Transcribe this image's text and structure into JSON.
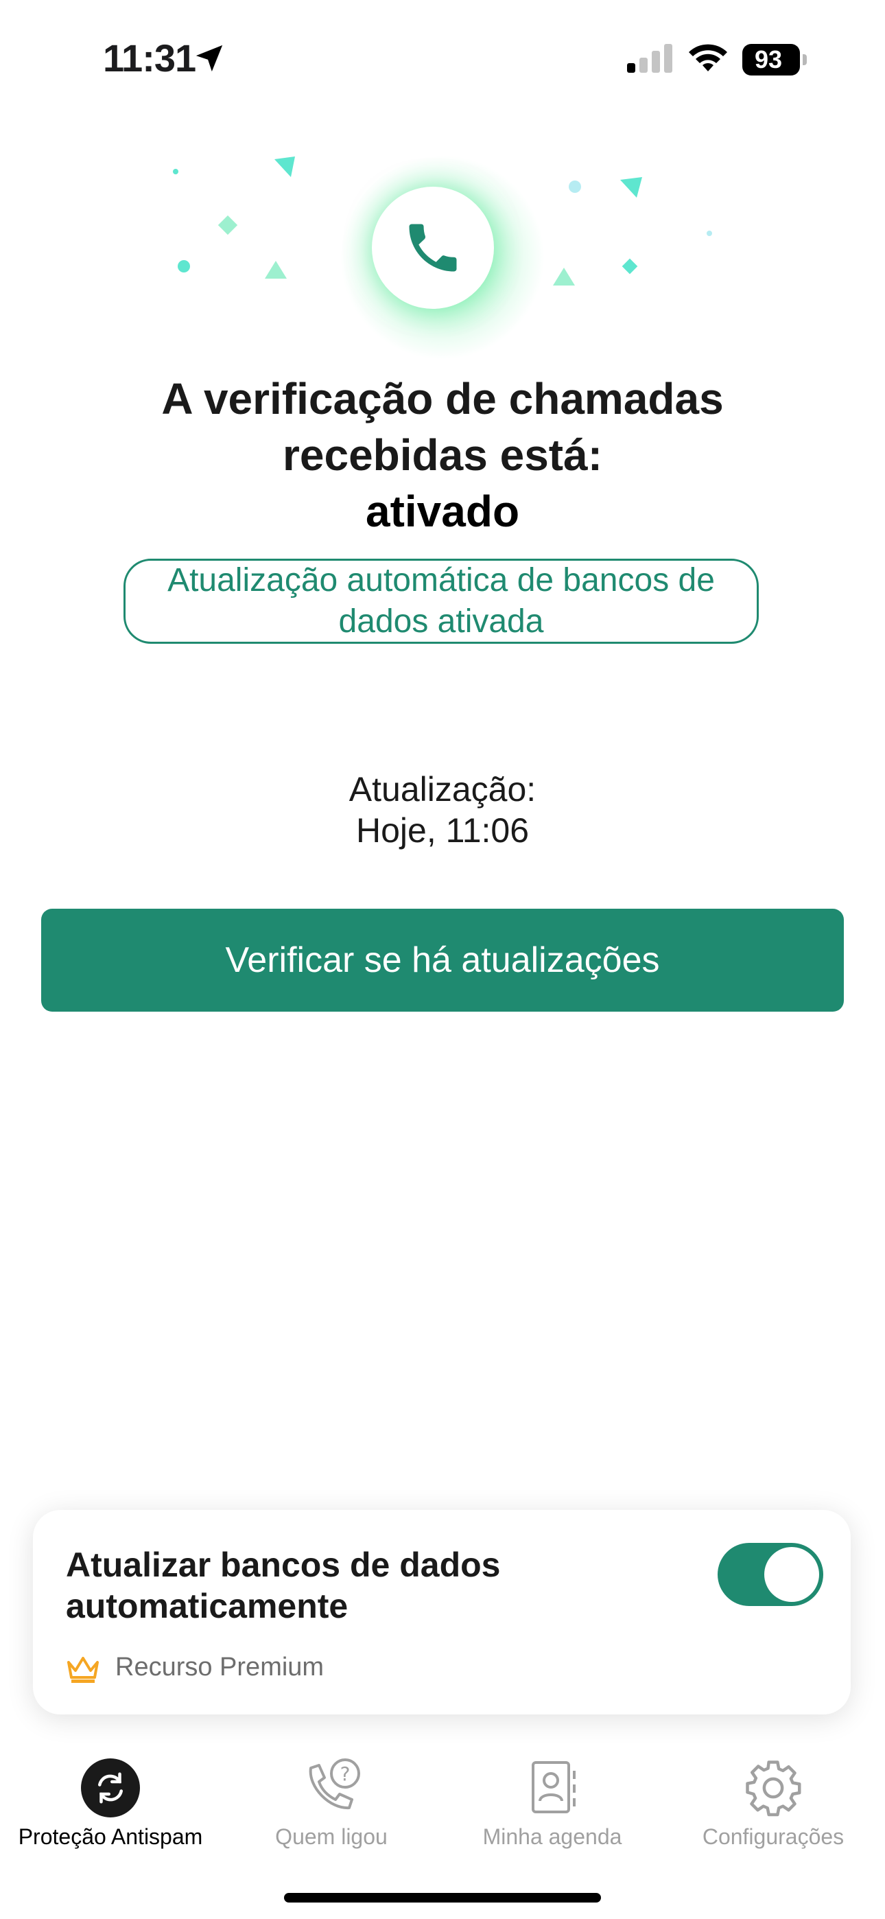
{
  "status_bar": {
    "time": "11:31",
    "battery": "93"
  },
  "main": {
    "heading_line1": "A verificação de chamadas",
    "heading_line2": "recebidas está:",
    "heading_status": "ativado",
    "auto_update_badge": "Atualização automática de bancos de dados ativada",
    "update_label": "Atualização:",
    "update_time": "Hoje, 11:06",
    "check_button": "Verificar se há atualizações"
  },
  "card": {
    "title": "Atualizar bancos de dados automaticamente",
    "toggle_on": true,
    "premium_label": "Recurso Premium"
  },
  "tabs": [
    {
      "label": "Proteção Antispam",
      "icon": "sync-icon",
      "active": true
    },
    {
      "label": "Quem ligou",
      "icon": "phone-question-icon",
      "active": false
    },
    {
      "label": "Minha agenda",
      "icon": "contacts-book-icon",
      "active": false
    },
    {
      "label": "Configurações",
      "icon": "gear-icon",
      "active": false
    }
  ],
  "colors": {
    "accent": "#1f8a70",
    "decor": "#5ee6cf",
    "crown": "#f5a623"
  }
}
